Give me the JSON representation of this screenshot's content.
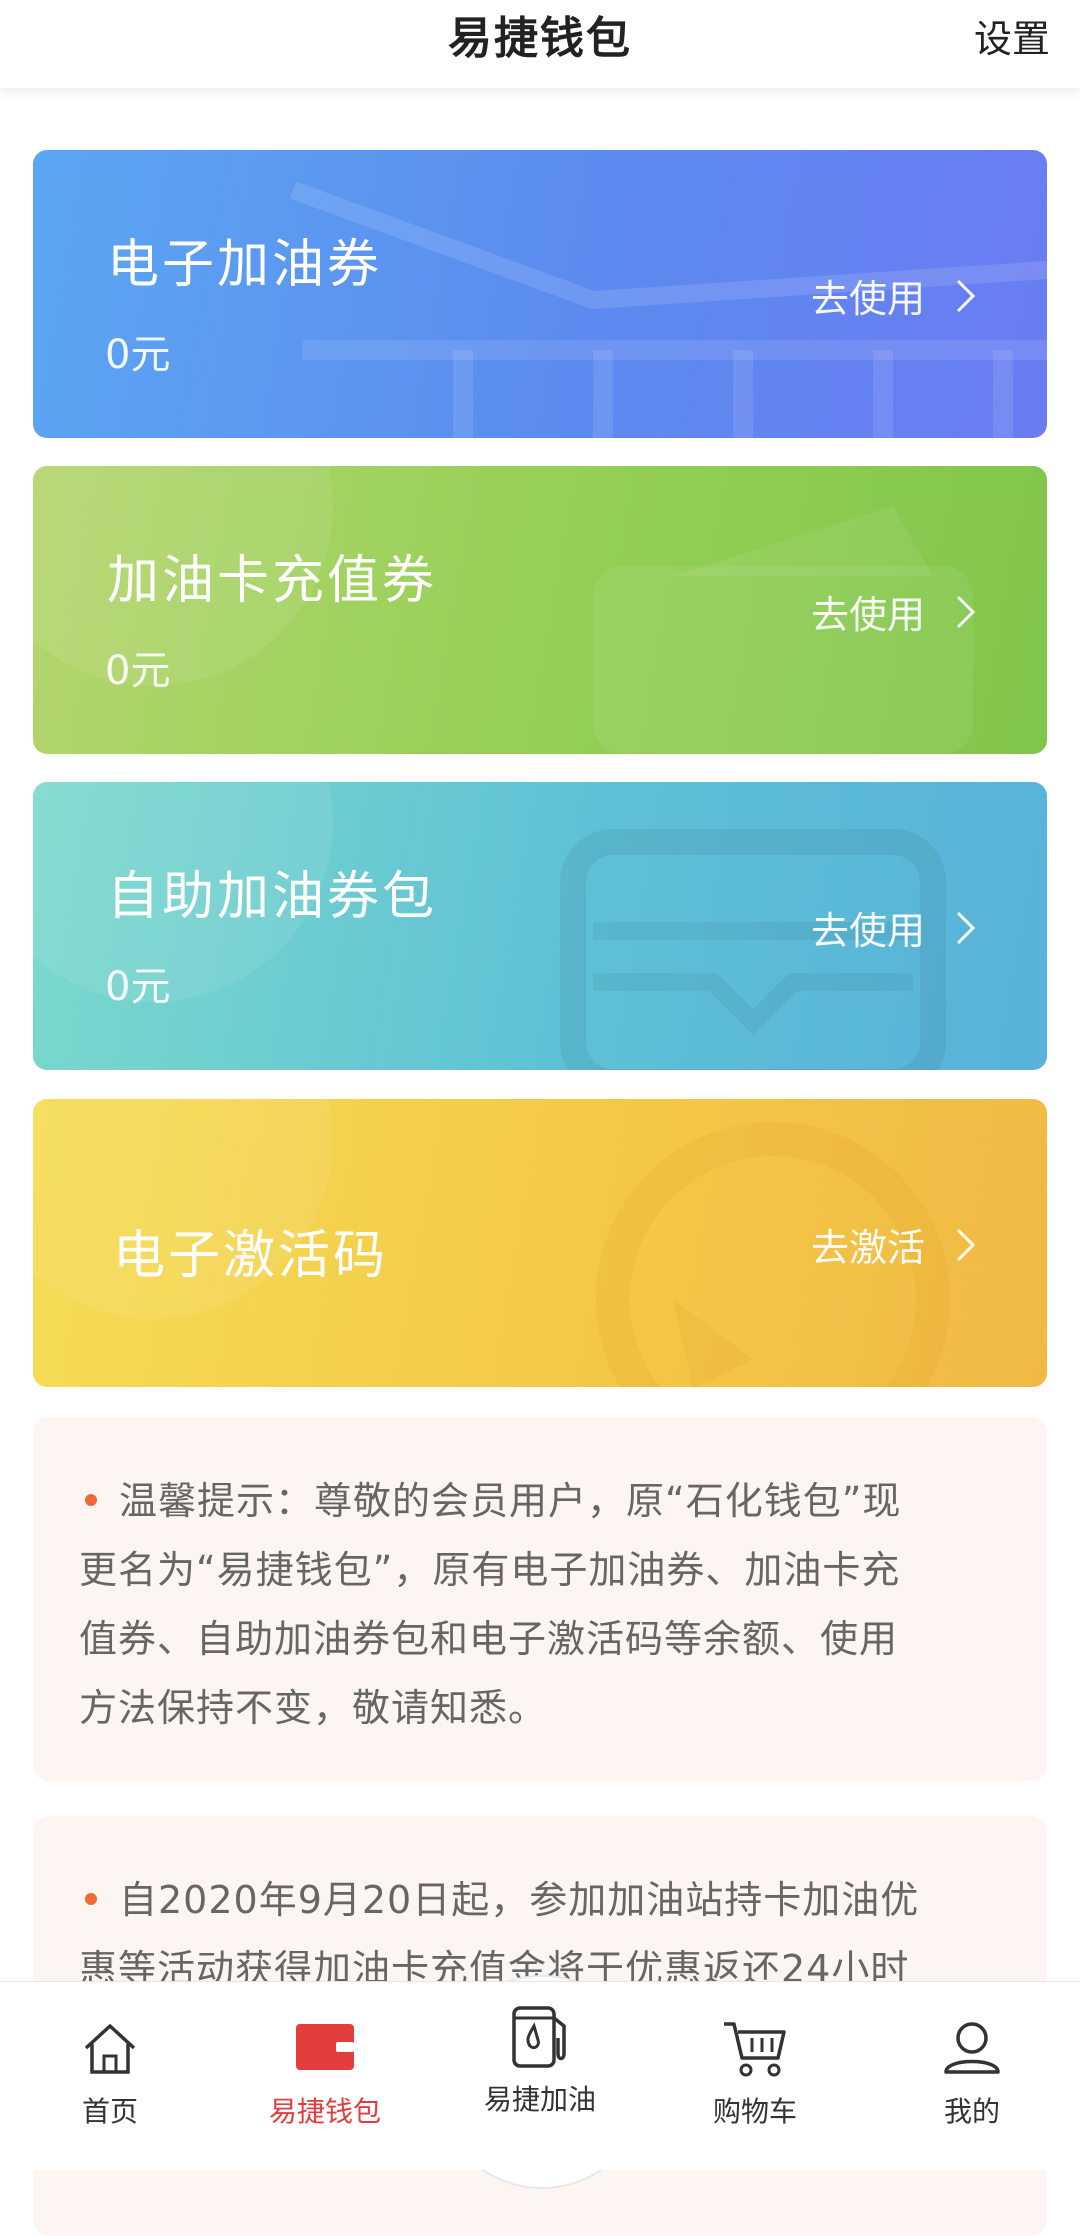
{
  "header": {
    "title": "易捷钱包",
    "settings_label": "设置"
  },
  "cards": [
    {
      "name": "电子加油券",
      "amount": "0元",
      "action": "去使用"
    },
    {
      "name": "加油卡充值券",
      "amount": "0元",
      "action": "去使用"
    },
    {
      "name": "自助加油券包",
      "amount": "0元",
      "action": "去使用"
    },
    {
      "name": "电子激活码",
      "action": "去激活"
    }
  ],
  "notices": [
    {
      "lines": [
        "温馨提示：尊敬的会员用户，原“石化钱包”现",
        "更名为“易捷钱包”，原有电子加油券、加油卡充",
        "值券、自助加油券包和电子激活码等余额、使用",
        "方法保持不变，敬请知悉。"
      ]
    },
    {
      "lines": [
        "自2020年9月20日起，参加加油站持卡加油优",
        "惠等活动获得加油卡充值金将于优惠返还24小时"
      ]
    }
  ],
  "tabbar": {
    "items": [
      {
        "label": "首页",
        "icon": "home-icon"
      },
      {
        "label": "易捷钱包",
        "icon": "wallet-icon",
        "active": true
      },
      {
        "label": "易捷加油",
        "icon": "fuel-pump-icon"
      },
      {
        "label": "购物车",
        "icon": "cart-icon"
      },
      {
        "label": "我的",
        "icon": "user-icon"
      }
    ]
  },
  "colors": {
    "accent_red": "#e43d3d",
    "notice_dot": "#ef6a37",
    "card_blue": "#5c8af0",
    "card_green": "#93cf55",
    "card_teal": "#5ec0d6",
    "card_yellow": "#f4c947"
  }
}
